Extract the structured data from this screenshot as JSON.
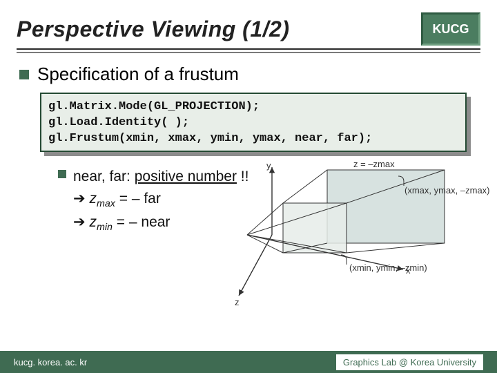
{
  "title": "Perspective Viewing (1/2)",
  "logo": "KUCG",
  "bullet": "Specification of a frustum",
  "code": {
    "line1": "gl.Matrix.Mode(GL_PROJECTION);",
    "line2": "gl.Load.Identity( );",
    "line3": "gl.Frustum(xmin, xmax, ymin, ymax, near, far);"
  },
  "sub": {
    "prefix": "near, far: ",
    "positive_number": "positive number",
    "bang": " !!",
    "zmax_lhs_var": "z",
    "zmax_lhs_sub": "max",
    "zmax_rhs": " = – far",
    "zmin_lhs_var": "z",
    "zmin_lhs_sub": "min",
    "zmin_rhs": " = – near"
  },
  "diagram": {
    "y": "y",
    "x": "x",
    "z": "z",
    "z_eq_zmax": "z = –zmax",
    "pt1a": "(xmax, ymax, –zmax)",
    "pt2a": "(xmin, ymin, –zmin)"
  },
  "footer": {
    "left": "kucg. korea. ac. kr",
    "right": "Graphics Lab @ Korea University"
  }
}
